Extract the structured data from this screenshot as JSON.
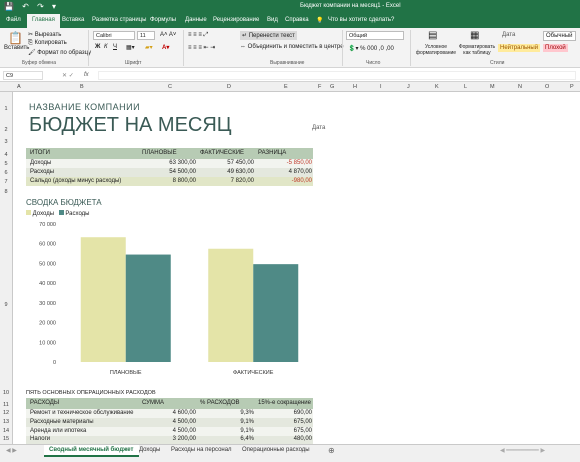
{
  "window": {
    "title": "Бюджет компании на месяц1 - Excel",
    "quick_access": "💾 ↶ ↷ ▾"
  },
  "ribbon_tabs": [
    "Файл",
    "Главная",
    "Вставка",
    "Разметка страницы",
    "Формулы",
    "Данные",
    "Рецензирование",
    "Вид",
    "Справка",
    "Что вы хотите сделать?"
  ],
  "ribbon": {
    "paste": "Вставить",
    "cut": "Вырезать",
    "copy": "Копировать",
    "format_painter": "Формат по образцу",
    "font_name": "Calibri",
    "font_size": "11",
    "bold": "Ж",
    "italic": "К",
    "underline": "Ч",
    "wrap": "Перенести текст",
    "merge": "Объединить и поместить в центре",
    "number_format": "Общий",
    "cond_format": "Условное форматирование",
    "format_table": "Форматировать как таблицу",
    "style_neutral": "Нейтральный",
    "style_bad": "Плохой",
    "style_normal": "Обычный",
    "style_date": "Дата",
    "group_clipboard": "Буфер обмена",
    "group_font": "Шрифт",
    "group_align": "Выравнивание",
    "group_number": "Число",
    "group_styles": "Стили"
  },
  "formula_bar": {
    "cell": "C9",
    "fx": "fx"
  },
  "columns": [
    "A",
    "B",
    "C",
    "D",
    "E",
    "F",
    "G",
    "H",
    "I",
    "J",
    "K",
    "L",
    "M",
    "N",
    "O",
    "P"
  ],
  "rows": [
    "1",
    "2",
    "3",
    "4",
    "5",
    "6",
    "7",
    "8",
    "9",
    "10",
    "11",
    "12",
    "13",
    "14",
    "15"
  ],
  "sheet": {
    "company": "НАЗВАНИЕ КОМПАНИИ",
    "title": "БЮДЖЕТ НА МЕСЯЦ",
    "date_label": "Дата",
    "summary_headers": [
      "ИТОГИ",
      "ПЛАНОВЫЕ",
      "ФАКТИЧЕСКИЕ",
      "РАЗНИЦА"
    ],
    "summary_rows": [
      [
        "Доходы",
        "63 300,00",
        "57 450,00",
        "-5 850,00"
      ],
      [
        "Расходы",
        "54 500,00",
        "49 630,00",
        "4 870,00"
      ],
      [
        "Сальдо (доходы минус расходы)",
        "8 800,00",
        "7 820,00",
        "-980,00"
      ]
    ],
    "expenses_title": "ПЯТЬ ОСНОВНЫХ ОПЕРАЦИОННЫХ РАСХОДОВ",
    "expense_headers": [
      "РАСХОДЫ",
      "СУММА",
      "% РАСХОДОВ",
      "15%-е сокращение"
    ],
    "expense_rows": [
      [
        "Ремонт и техническое обслуживание",
        "4 600,00",
        "9,3%",
        "690,00"
      ],
      [
        "Расходные материалы",
        "4 500,00",
        "9,1%",
        "675,00"
      ],
      [
        "Аренда или ипотека",
        "4 500,00",
        "9,1%",
        "675,00"
      ],
      [
        "Налоги",
        "3 200,00",
        "6,4%",
        "480,00"
      ]
    ]
  },
  "chart_data": {
    "type": "bar",
    "title": "СВОДКА БЮДЖЕТА",
    "categories": [
      "ПЛАНОВЫЕ",
      "ФАКТИЧЕСКИЕ"
    ],
    "series": [
      {
        "name": "Доходы",
        "values": [
          63300,
          57450
        ],
        "color": "#e4e4a8"
      },
      {
        "name": "Расходы",
        "values": [
          54500,
          49630
        ],
        "color": "#4f8a86"
      }
    ],
    "ylim": [
      0,
      70000
    ],
    "yticks": [
      "70 000",
      "60 000",
      "50 000",
      "40 000",
      "30 000",
      "20 000",
      "10 000",
      "0"
    ],
    "legend": "top-left",
    "grid": false
  },
  "sheet_tabs": [
    "Сводный месячный бюджет",
    "Доходы",
    "Расходы на персонал",
    "Операционные расходы"
  ],
  "colors": {
    "accent": "#217346",
    "header_fill": "#b7cbb4",
    "row_fill": "#e4e8de",
    "negative": "#c0392b"
  }
}
